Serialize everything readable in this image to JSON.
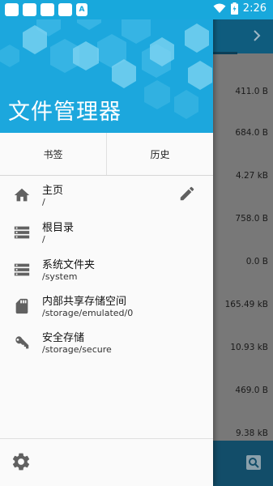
{
  "status_bar": {
    "time": "2:26",
    "left_icons": [
      "notification-icon",
      "notification-icon",
      "notification-icon",
      "notification-icon",
      "app-a-icon"
    ],
    "app_icon_letter": "A",
    "right_icons": [
      "wifi-icon",
      "battery-icon"
    ]
  },
  "drawer": {
    "app_title": "文件管理器",
    "tabs": [
      {
        "label": "书签"
      },
      {
        "label": "历史"
      }
    ],
    "items": [
      {
        "title": "主页",
        "path": "/",
        "icon": "home-icon"
      },
      {
        "title": "根目录",
        "path": "/",
        "icon": "storage-icon"
      },
      {
        "title": "系统文件夹",
        "path": "/system",
        "icon": "storage-icon"
      },
      {
        "title": "内部共享存储空间",
        "path": "/storage/emulated/0",
        "icon": "sd-card-icon"
      },
      {
        "title": "安全存储",
        "path": "/storage/secure",
        "icon": "key-icon"
      }
    ],
    "edit_icon": "pencil-icon",
    "settings_icon": "gear-icon"
  },
  "background_list": {
    "sizes": [
      "411.0 B",
      "684.0 B",
      "4.27 kB",
      "758.0 B",
      "0.0 B",
      "165.49 kB",
      "10.93 kB",
      "469.0 B",
      "9.38 kB"
    ]
  },
  "colors": {
    "status_bar": "#18a8dc",
    "header": "#1ca7dd",
    "toolbar": "#0f5c7e",
    "drawer_bg": "#fafafa"
  }
}
